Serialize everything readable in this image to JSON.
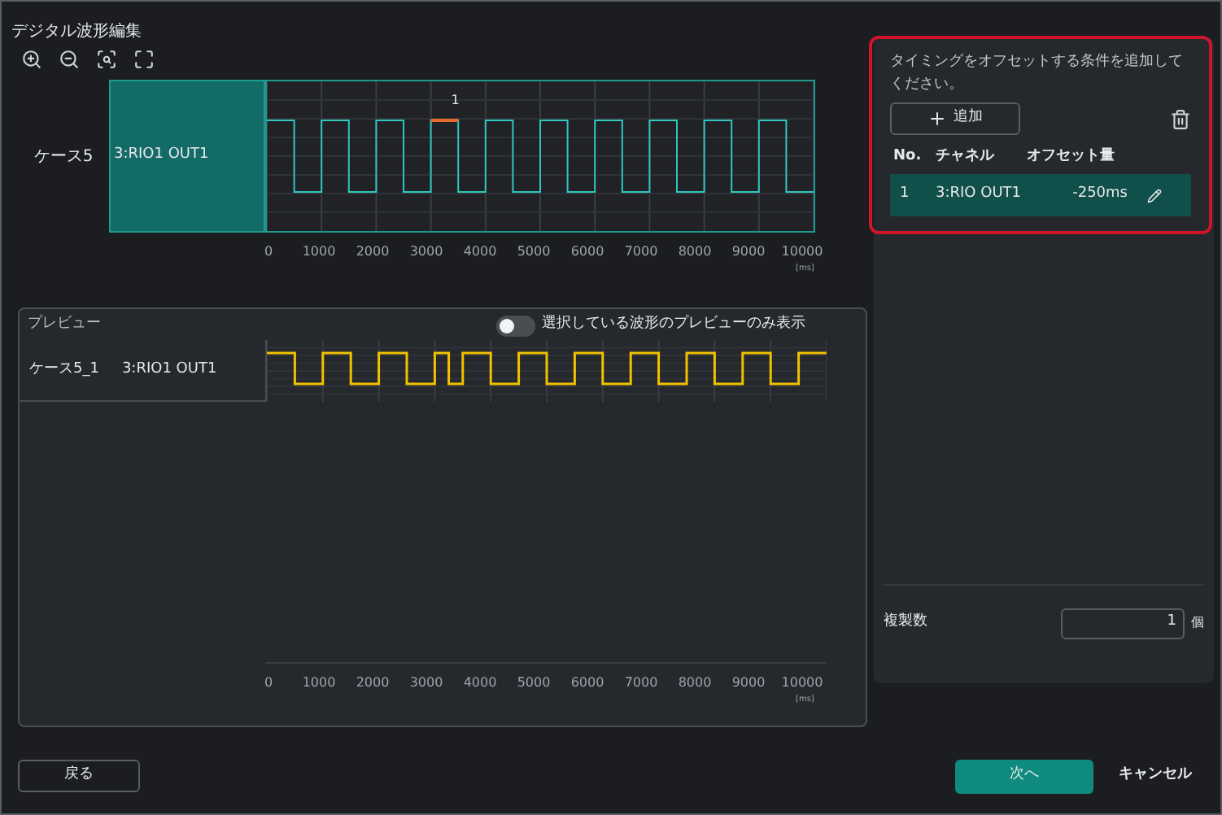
{
  "window": {
    "title": "デジタル波形編集"
  },
  "waveform": {
    "case": "ケース5",
    "channel": "3:RIO1 OUT1",
    "marker": "1",
    "ticks": [
      "0",
      "1000",
      "2000",
      "3000",
      "4000",
      "5000",
      "6000",
      "7000",
      "8000",
      "9000",
      "10000"
    ],
    "unit": "[ms]"
  },
  "preview": {
    "title": "プレビュー",
    "toggle": {
      "label": "選択している波形のプレビューのみ表示",
      "on": false
    },
    "case": "ケース5_1",
    "channel": "3:RIO1 OUT1",
    "ticks": [
      "0",
      "1000",
      "2000",
      "3000",
      "4000",
      "5000",
      "6000",
      "7000",
      "8000",
      "9000",
      "10000"
    ],
    "unit": "[ms]"
  },
  "offset_panel": {
    "instruction": "タイミングをオフセットする条件を追加してください。",
    "add_button": "追加",
    "columns": [
      "No.",
      "チャネル",
      "オフセット量"
    ],
    "rows": [
      {
        "no": "1",
        "channel": "3:RIO OUT1",
        "offset": "-250ms",
        "selected": true
      }
    ]
  },
  "copies": {
    "label": "複製数",
    "value": "1",
    "unit": "個"
  },
  "buttons": {
    "back": "戻る",
    "next": "次へ",
    "cancel": "キャンセル"
  }
}
